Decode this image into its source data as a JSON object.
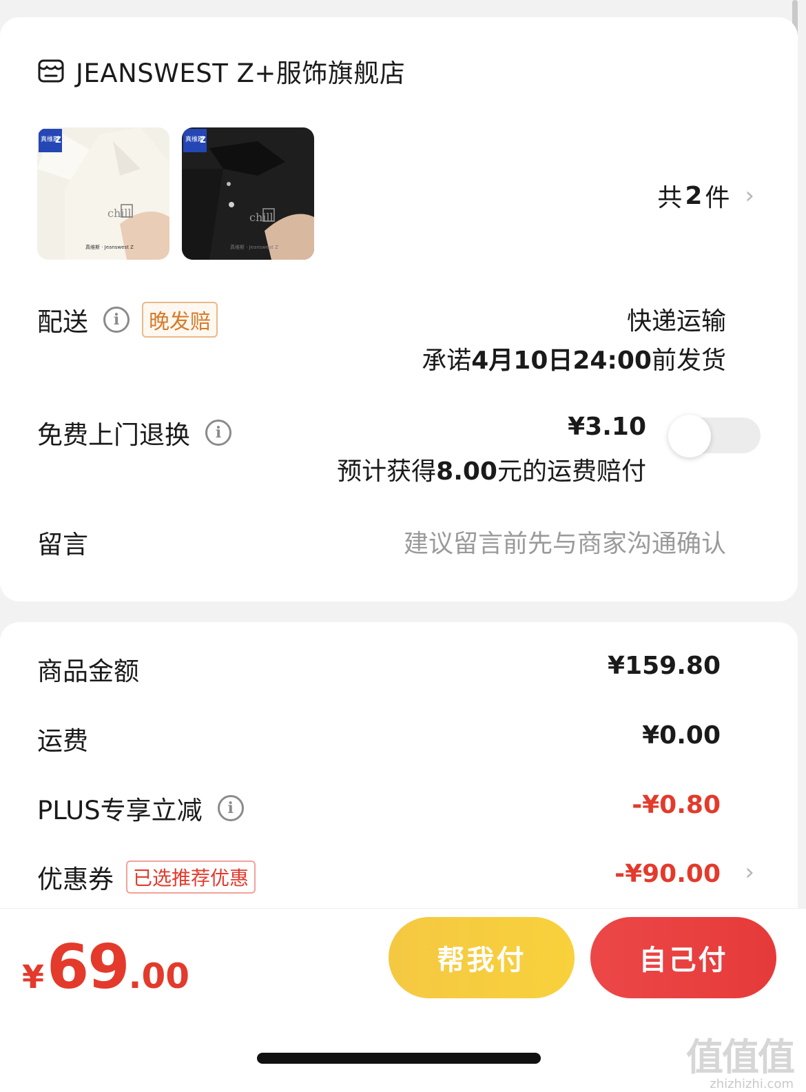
{
  "store": {
    "name": "JEANSWEST Z+服饰旗舰店",
    "icon": "store-icon"
  },
  "products": {
    "items": [
      {
        "color": "white",
        "bg": "#f4f1ea",
        "shirt": "#f7f5ef",
        "logo": "chill國"
      },
      {
        "color": "black",
        "bg": "#2a2a2a",
        "shirt": "#1a1a1a",
        "logo": "chill國"
      }
    ],
    "count_prefix": "共",
    "count_num": "2",
    "count_suffix": "件"
  },
  "delivery": {
    "label": "配送",
    "tag": "晚发赔",
    "method": "快递运输",
    "promise_prefix": "承诺",
    "promise_bold": "4月10日24:00",
    "promise_suffix": "前发货"
  },
  "return": {
    "label": "免费上门退换",
    "price": "¥3.10",
    "desc_prefix": "预计获得",
    "desc_bold": "8.00",
    "desc_suffix": "元的运费赔付",
    "enabled": false
  },
  "message": {
    "label": "留言",
    "placeholder": "建议留言前先与商家沟通确认"
  },
  "summary": {
    "goods_label": "商品金额",
    "goods_value": "¥159.80",
    "shipping_label": "运费",
    "shipping_value": "¥0.00",
    "plus_label": "PLUS专享立减",
    "plus_value": "-¥0.80",
    "coupon_label": "优惠券",
    "coupon_tag": "已选推荐优惠",
    "coupon_value": "-¥90.00"
  },
  "bottom": {
    "currency": "¥",
    "total_int": "69",
    "total_dec": ".00",
    "help_pay": "帮我付",
    "self_pay": "自己付"
  },
  "watermark": {
    "main": "值值值",
    "sub": "zhizhizhi.com"
  },
  "colors": {
    "accent_red": "#e33a2c",
    "help_yellow": "#f5c842",
    "self_red": "#ec4747",
    "tag_orange": "#d67a2a"
  }
}
